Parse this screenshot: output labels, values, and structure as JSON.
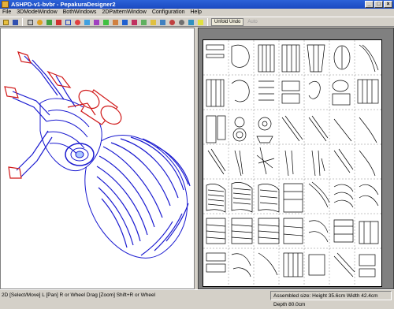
{
  "window": {
    "title": "ASHPD-v1-bvbr - PepakuraDesigner2"
  },
  "menu": [
    "File",
    "3DModeWindow",
    "BothWindows",
    "2DPatternWindow",
    "Configuration",
    "Help"
  ],
  "toolbar": {
    "icons": [
      "open-icon",
      "save-icon",
      "print-icon",
      "rotate-icon",
      "move-icon",
      "select-icon",
      "edge-icon",
      "zoom-icon",
      "unfold-icon",
      "fold-icon",
      "face-icon",
      "texture-icon",
      "join-icon",
      "cut-icon",
      "flap-icon",
      "text-icon",
      "image-icon",
      "refresh-icon",
      "gear-icon",
      "arrange-icon",
      "help-icon"
    ],
    "unfold_undo": "Unfold Undo",
    "auto": "Auto"
  },
  "status": {
    "left": "2D [Select/Move] L [Pan] R or Wheel Drag [Zoom] Shift+R or Wheel",
    "right": "Assembled size: Height 35.6cm Width 42.4cm Depth 80.0cm"
  },
  "colors": {
    "model_blue": "#1a1ad0",
    "model_red": "#d01818",
    "titlebar": "#2c62d8",
    "pane_bg": "#808080"
  }
}
